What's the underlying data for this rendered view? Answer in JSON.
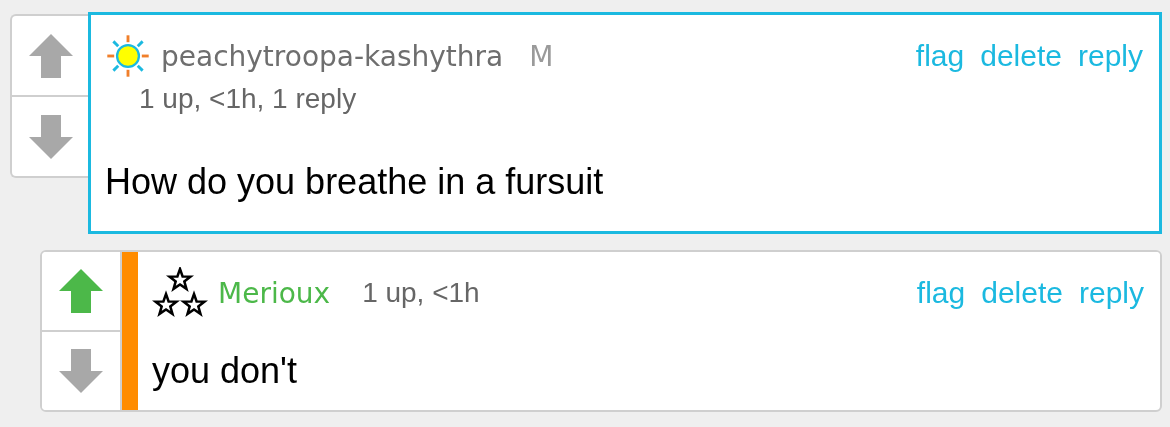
{
  "comments": [
    {
      "highlighted": true,
      "op_reply": false,
      "upvoted": false,
      "downvoted": false,
      "author": {
        "name": "peachytroopa-kashythra",
        "color": "#6e6e6e",
        "badge": {
          "kind": "sun"
        },
        "tag": "M"
      },
      "meta": "1 up, <1h, 1 reply",
      "meta_inline": false,
      "actions": [
        "flag",
        "delete",
        "reply"
      ],
      "text": "How do you breathe in a fursuit"
    },
    {
      "highlighted": false,
      "op_reply": true,
      "upvoted": true,
      "downvoted": false,
      "author": {
        "name": "Merioux",
        "color": "#4cb849",
        "badge": {
          "kind": "stars"
        }
      },
      "meta": "1 up, <1h",
      "meta_inline": true,
      "actions": [
        "flag",
        "delete",
        "reply"
      ],
      "text": "you don't"
    }
  ]
}
